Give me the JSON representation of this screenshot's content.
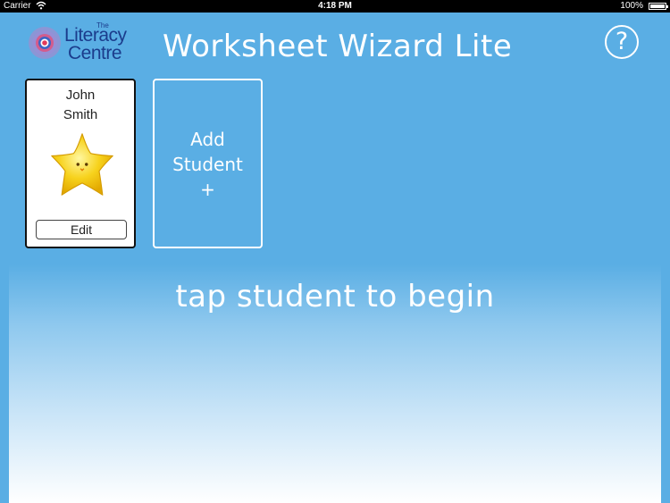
{
  "status_bar": {
    "carrier": "Carrier",
    "time": "4:18 PM",
    "battery": "100%",
    "battery_level": 1.0
  },
  "header": {
    "logo": {
      "the": "The",
      "line1": "Literacy",
      "line2": "Centre"
    },
    "title": "Worksheet Wizard Lite",
    "help_label": "?"
  },
  "students": [
    {
      "first_name": "John",
      "last_name": "Smith",
      "avatar_icon": "star-icon",
      "edit_label": "Edit"
    }
  ],
  "add_student": {
    "line1": "Add",
    "line2": "Student",
    "line3": "+"
  },
  "prompt": "tap student to begin",
  "colors": {
    "background": "#5aaee4",
    "logo_text": "#1b3c8c",
    "star": "#f7d21c"
  }
}
